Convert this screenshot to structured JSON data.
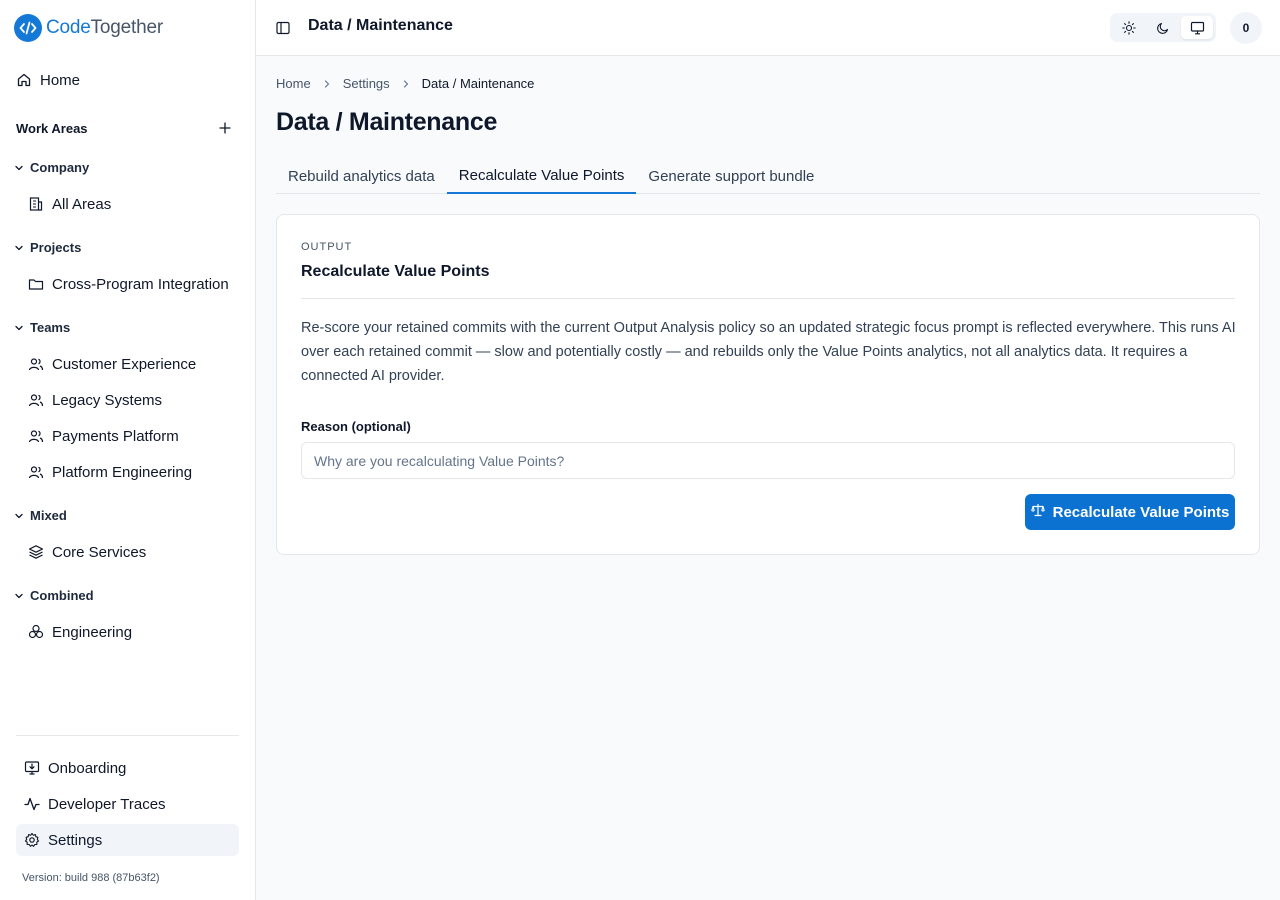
{
  "app": {
    "brand_part1": "Code",
    "brand_part2": "Together",
    "brand_color": "#1479d6"
  },
  "sidebar": {
    "home_label": "Home",
    "work_areas_title": "Work Areas",
    "groups": [
      {
        "label": "Company",
        "items": [
          {
            "label": "All Areas",
            "icon": "building-icon"
          }
        ]
      },
      {
        "label": "Projects",
        "items": [
          {
            "label": "Cross-Program Integration",
            "icon": "folder-icon"
          }
        ]
      },
      {
        "label": "Teams",
        "items": [
          {
            "label": "Customer Experience",
            "icon": "users-icon"
          },
          {
            "label": "Legacy Systems",
            "icon": "users-icon"
          },
          {
            "label": "Payments Platform",
            "icon": "users-icon"
          },
          {
            "label": "Platform Engineering",
            "icon": "users-icon"
          }
        ]
      },
      {
        "label": "Mixed",
        "items": [
          {
            "label": "Core Services",
            "icon": "layers-icon"
          }
        ]
      },
      {
        "label": "Combined",
        "items": [
          {
            "label": "Engineering",
            "icon": "boxes-icon"
          }
        ]
      }
    ],
    "bottom": [
      {
        "label": "Onboarding",
        "icon": "monitor-download-icon"
      },
      {
        "label": "Developer Traces",
        "icon": "activity-icon"
      },
      {
        "label": "Settings",
        "icon": "gear-icon",
        "active": true
      }
    ],
    "version": "Version: build 988 (87b63f2)"
  },
  "header": {
    "title": "Data / Maintenance",
    "avatar_text": "0",
    "theme_options": [
      "light",
      "dark",
      "system"
    ],
    "theme_selected": "system"
  },
  "breadcrumb": [
    "Home",
    "Settings",
    "Data / Maintenance"
  ],
  "page": {
    "title": "Data / Maintenance",
    "tabs": [
      {
        "label": "Rebuild analytics data",
        "active": false
      },
      {
        "label": "Recalculate Value Points",
        "active": true
      },
      {
        "label": "Generate support bundle",
        "active": false
      }
    ]
  },
  "card": {
    "eyebrow": "OUTPUT",
    "title": "Recalculate Value Points",
    "description": "Re-score your retained commits with the current Output Analysis policy so an updated strategic focus prompt is reflected everywhere. This runs AI over each retained commit — slow and potentially costly — and rebuilds only the Value Points analytics, not all analytics data. It requires a connected AI provider.",
    "reason_label": "Reason (optional)",
    "reason_value": "",
    "reason_placeholder": "Why are you recalculating Value Points?",
    "button_label": "Recalculate Value Points",
    "button_color": "#0b72d2"
  }
}
